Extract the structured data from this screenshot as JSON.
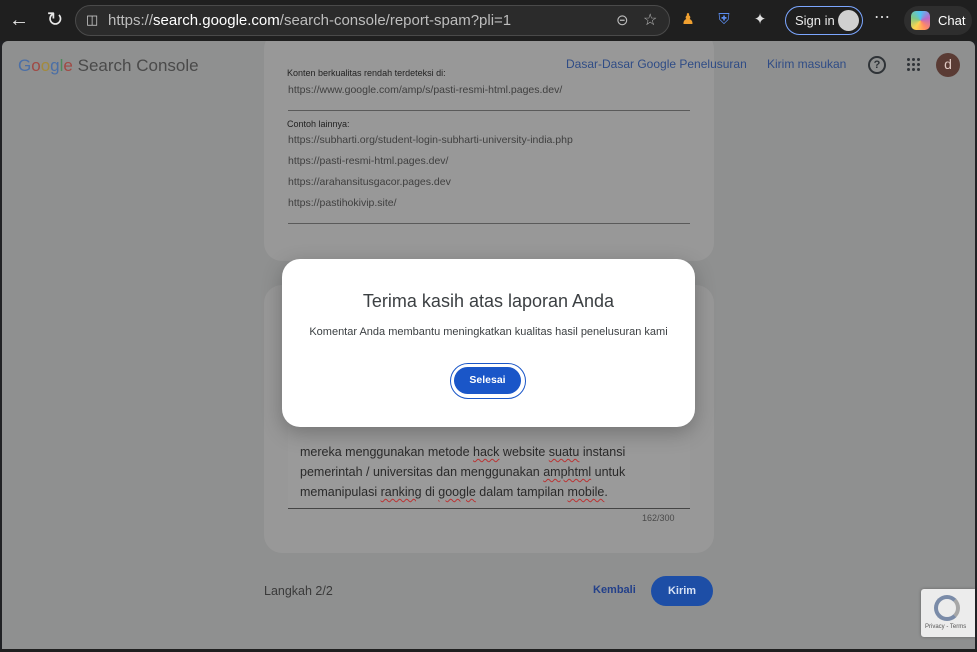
{
  "browser": {
    "url_scheme": "https://",
    "url_host": "search.google.com",
    "url_path": "/search-console/report-spam?pli=1",
    "sign_in_label": "Sign in",
    "chat_label": "Chat"
  },
  "header": {
    "logo_letters": [
      "G",
      "o",
      "o",
      "g",
      "l",
      "e"
    ],
    "logo_product": "Search Console",
    "nav_links": [
      "Dasar-Dasar Google Penelusuran",
      "Kirim masukan"
    ],
    "help_icon": "?",
    "avatar_letter": "d"
  },
  "evidence": {
    "low_quality_label": "Konten berkualitas rendah terdeteksi di:",
    "low_quality_url": "https://www.google.com/amp/s/pasti-resmi-html.pages.dev/",
    "other_examples_label": "Contoh lainnya:",
    "other_examples": [
      "https://subharti.org/student-login-subharti-university-india.php",
      "https://pasti-resmi-html.pages.dev/",
      "https://arahansitusgacor.pages.dev",
      "https://pastihokivip.site/"
    ]
  },
  "comment": {
    "part1": "mereka menggunakan metode ",
    "w1": "hack",
    "part2": " website ",
    "w2": "suatu",
    "part3": " instansi pemerintah / universitas dan menggunakan ",
    "w3": "amphtml",
    "part4": " untuk memanipulasi ",
    "w4": "ranking",
    "part5": " di ",
    "w5": "google",
    "part6": " dalam tampilan ",
    "w6": "mobile",
    "part7": ".",
    "counter": "162/300"
  },
  "footer": {
    "step_label": "Langkah 2/2",
    "back_label": "Kembali",
    "send_label": "Kirim",
    "recaptcha_terms": "Privacy - Terms"
  },
  "dialog": {
    "title": "Terima kasih atas laporan Anda",
    "message": "Komentar Anda membantu meningkatkan kualitas hasil penelusuran kami",
    "done_label": "Selesai"
  },
  "colors": {
    "accent": "#1a56c8",
    "overlay_bg": "#8f9090"
  }
}
